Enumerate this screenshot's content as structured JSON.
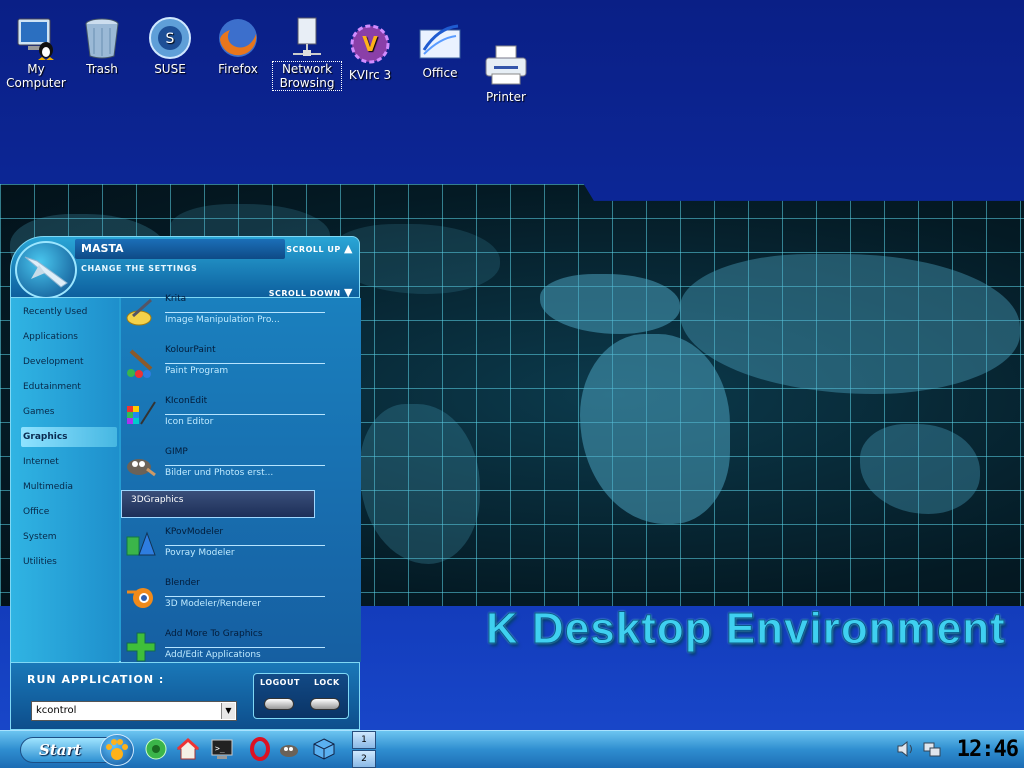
{
  "desktop": {
    "icons": [
      {
        "label": "My\nComputer",
        "icon": "computer-icon"
      },
      {
        "label": "Trash",
        "icon": "trash-icon"
      },
      {
        "label": "SUSE",
        "icon": "suse-icon"
      },
      {
        "label": "Firefox",
        "icon": "firefox-icon"
      },
      {
        "label": "Network\nBrowsing",
        "icon": "network-icon"
      },
      {
        "label": "KVIrc 3",
        "icon": "kvirc-icon"
      },
      {
        "label": "Office",
        "icon": "office-icon"
      },
      {
        "label": "Printer",
        "icon": "printer-icon"
      }
    ],
    "banner": "K Desktop Environment"
  },
  "menu": {
    "user": "MASTA",
    "change_settings": "CHANGE THE SETTINGS",
    "scroll_up": "SCROLL UP",
    "scroll_down": "SCROLL DOWN",
    "categories": [
      "Recently Used",
      "Applications",
      "Development",
      "Edutainment",
      "Games",
      "Graphics",
      "Internet",
      "Multimedia",
      "Office",
      "System",
      "Utilities"
    ],
    "active_category": "Graphics",
    "apps": [
      {
        "name": "Krita",
        "desc": "Image Manipulation Pro..."
      },
      {
        "name": "KolourPaint",
        "desc": "Paint Program"
      },
      {
        "name": "KIconEdit",
        "desc": "Icon Editor"
      },
      {
        "name": "GIMP",
        "desc": "Bilder und Photos erst..."
      },
      {
        "name": "KPovModeler",
        "desc": "Povray Modeler"
      },
      {
        "name": "Blender",
        "desc": "3D Modeler/Renderer"
      },
      {
        "name": "Add More To Graphics",
        "desc": "Add/Edit Applications"
      }
    ],
    "group": "3DGraphics",
    "run_label": "RUN APPLICATION :",
    "run_value": "kcontrol",
    "logout": "LOGOUT",
    "lock": "LOCK"
  },
  "taskbar": {
    "start": "Start",
    "pager": [
      "1",
      "2"
    ],
    "clock": "12:46"
  },
  "colors": {
    "accent": "#27a4d6",
    "desktop": "#0f2fa8"
  }
}
